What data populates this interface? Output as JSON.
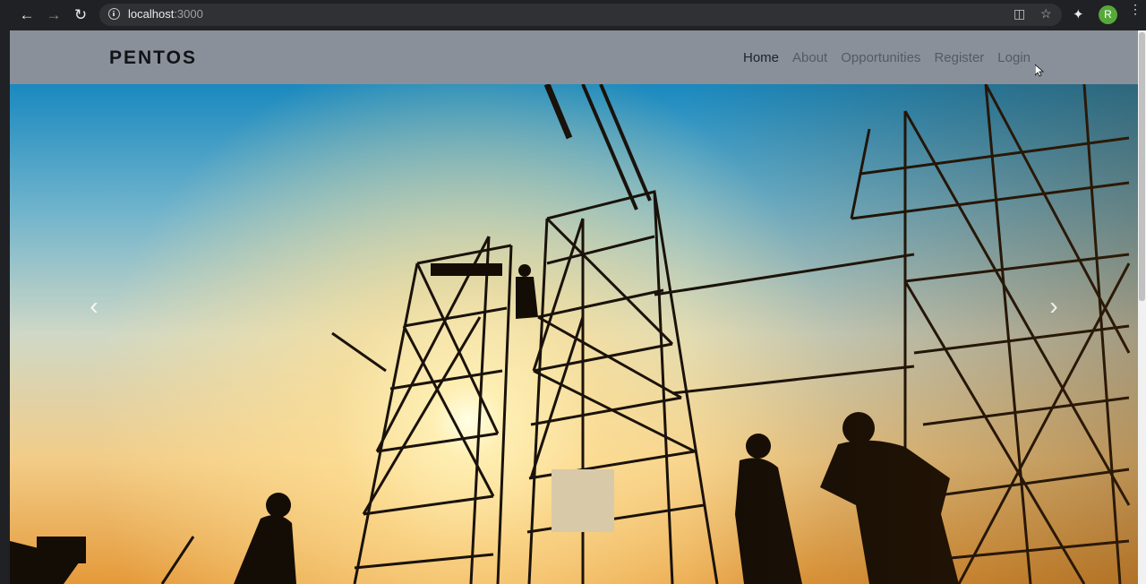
{
  "browser": {
    "url_host": "localhost",
    "url_port": ":3000",
    "profile_initial": "R",
    "icons": [
      "back-arrow-icon",
      "forward-arrow-icon",
      "reload-icon",
      "info-icon",
      "translate-icon",
      "star-icon",
      "puzzle-extension-icon",
      "kebab-menu-icon"
    ]
  },
  "site": {
    "brand": "PENTOS",
    "nav": [
      {
        "label": "Home",
        "active": true
      },
      {
        "label": "About",
        "active": false
      },
      {
        "label": "Opportunities",
        "active": false
      },
      {
        "label": "Register",
        "active": false
      },
      {
        "label": "Login",
        "active": false
      }
    ]
  },
  "hero": {
    "prev_glyph": "‹",
    "next_glyph": "›"
  },
  "colors": {
    "navbar_bg": "#8a9099",
    "brand_text": "#111317",
    "avatar_bg": "#57a83b"
  }
}
